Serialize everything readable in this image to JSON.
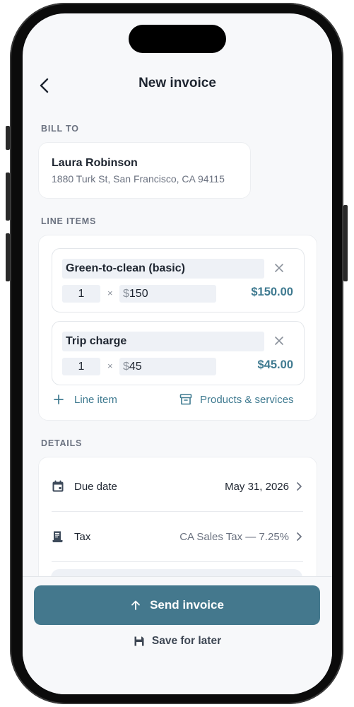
{
  "header": {
    "title": "New invoice"
  },
  "bill_to": {
    "section_label": "BILL TO",
    "name": "Laura Robinson",
    "address": "1880 Turk St, San Francisco, CA 94115"
  },
  "line_items": {
    "section_label": "LINE ITEMS",
    "items": [
      {
        "name": "Green-to-clean (basic)",
        "qty": "1",
        "times": "×",
        "currency": "$",
        "price": "150",
        "total": "$150.00"
      },
      {
        "name": "Trip charge",
        "qty": "1",
        "times": "×",
        "currency": "$",
        "price": "45",
        "total": "$45.00"
      }
    ],
    "add_line_item_label": "Line item",
    "products_services_label": "Products & services"
  },
  "details": {
    "section_label": "DETAILS",
    "due_date": {
      "label": "Due date",
      "value": "May 31, 2026"
    },
    "tax": {
      "label": "Tax",
      "value": "CA Sales Tax — 7.25%"
    }
  },
  "footer": {
    "send_label": "Send invoice",
    "save_label": "Save for later"
  },
  "colors": {
    "accent": "#44788d",
    "accent_text": "#3f7a90",
    "background": "#f7f8fa"
  },
  "icons": [
    "back-chevron-icon",
    "close-icon",
    "plus-icon",
    "archive-box-icon",
    "calendar-icon",
    "receipt-icon",
    "chevron-right-icon",
    "arrow-up-icon",
    "save-disk-icon"
  ]
}
